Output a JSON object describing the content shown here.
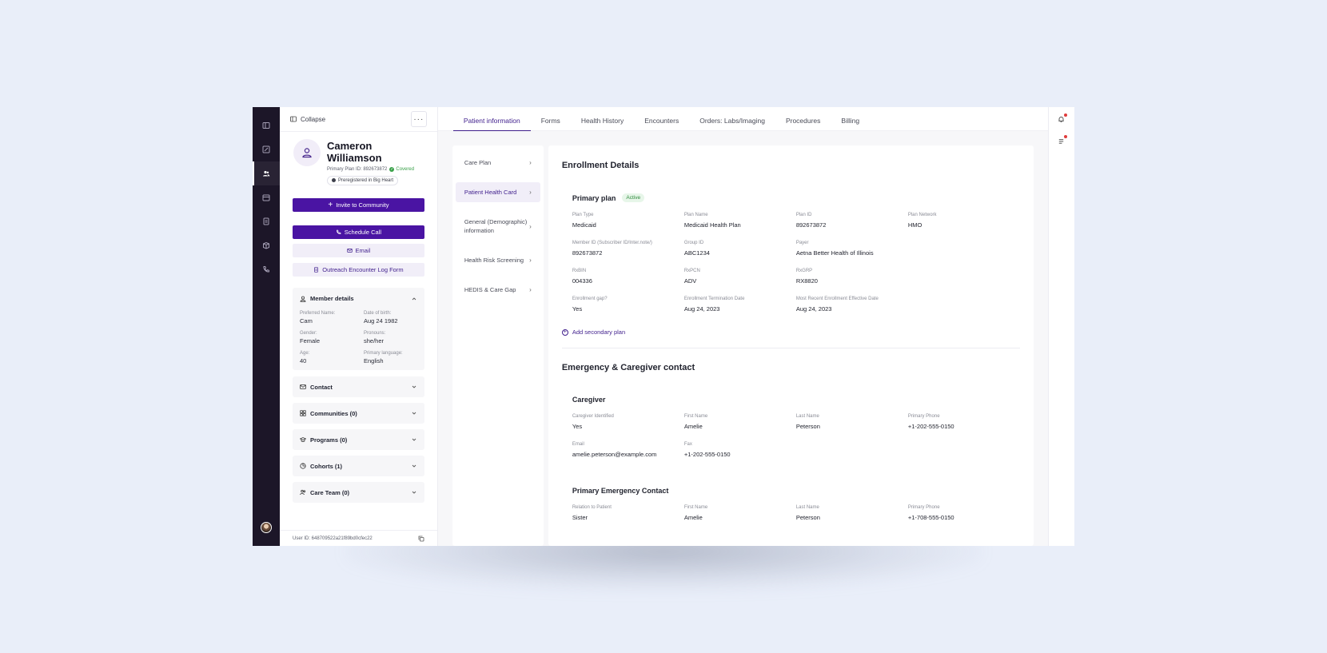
{
  "colors": {
    "accent": "#4a14a3",
    "rail": "#1c1628",
    "covered": "#3aa14a",
    "active_badge_bg": "#e7f6e9",
    "notification": "#e03c3c"
  },
  "rail": {
    "icons": [
      "sidebar-toggle-icon",
      "edit-note-icon",
      "users-icon",
      "calendar-icon",
      "document-icon",
      "box-icon",
      "phone-icon"
    ],
    "active_index": 2
  },
  "panel": {
    "collapse_label": "Collapse",
    "more_label": "···",
    "patient": {
      "name": "Cameron Williamson",
      "primary_plan_id": "Primary Plan ID: 892673872",
      "coverage_status": "Covered",
      "preregistered": "Preregistered in Big Heart"
    },
    "buttons": {
      "invite": "Invite to Community",
      "schedule": "Schedule Call",
      "email": "Email",
      "outreach": "Outreach Encounter Log Form"
    },
    "member_details": {
      "title": "Member details",
      "fields": [
        {
          "label": "Preferred Name:",
          "value": "Cam"
        },
        {
          "label": "Date of birth:",
          "value": "Aug 24 1982"
        },
        {
          "label": "Gender:",
          "value": "Female"
        },
        {
          "label": "Pronouns:",
          "value": "she/her"
        },
        {
          "label": "Age:",
          "value": "40"
        },
        {
          "label": "Primary language:",
          "value": "English"
        }
      ]
    },
    "sections": [
      "Contact",
      "Communities (0)",
      "Programs (0)",
      "Cohorts (1)",
      "Care Team (0)"
    ],
    "user_id": "User ID: 648709522a21f89bd0cfec22"
  },
  "tabs": [
    "Patient information",
    "Forms",
    "Health History",
    "Encounters",
    "Orders: Labs/Imaging",
    "Procedures",
    "Billing"
  ],
  "active_tab": 0,
  "subnav": [
    "Care Plan",
    "Patient Health Card",
    "General (Demographic) information",
    "Health Risk Screening",
    "HEDIS & Care Gap"
  ],
  "active_subnav": 1,
  "enrollment": {
    "title": "Enrollment Details",
    "primary_plan": {
      "title": "Primary plan",
      "status": "Active",
      "rows": [
        [
          {
            "label": "Plan Type",
            "value": "Medicaid"
          },
          {
            "label": "Plan Name",
            "value": "Medicaid Health Plan"
          },
          {
            "label": "Plan ID",
            "value": "892673872"
          },
          {
            "label": "Plan Network",
            "value": "HMO"
          }
        ],
        [
          {
            "label": "Member ID (Subscriber ID/Inter.note/)",
            "value": "892673872"
          },
          {
            "label": "Group ID",
            "value": "ABC1234"
          },
          {
            "label": "Payer",
            "value": "Aetna Better Health of Illinois"
          }
        ],
        [
          {
            "label": "RxBIN",
            "value": "004336"
          },
          {
            "label": "RxPCN",
            "value": "ADV"
          },
          {
            "label": "RxGRP",
            "value": "RX8820"
          }
        ],
        [
          {
            "label": "Enrollment gap?",
            "value": "Yes"
          },
          {
            "label": "Enrollment Termination Date",
            "value": "Aug 24, 2023"
          },
          {
            "label": "Most Recent Enrollment Effective Date",
            "value": "Aug 24, 2023"
          }
        ]
      ]
    },
    "add_secondary": "Add secondary plan"
  },
  "emergency": {
    "title": "Emergency & Caregiver contact",
    "caregiver": {
      "title": "Caregiver",
      "rows": [
        [
          {
            "label": "Caregiver Identified",
            "value": "Yes"
          },
          {
            "label": "First Name",
            "value": "Amelie"
          },
          {
            "label": "Last Name",
            "value": "Peterson"
          },
          {
            "label": "Primary Phone",
            "value": "+1-202-555-0150"
          }
        ],
        [
          {
            "label": "Email",
            "value": "amelie.peterson@example.com"
          },
          {
            "label": "Fax",
            "value": "+1-202-555-0150"
          }
        ]
      ]
    },
    "primary_contact": {
      "title": "Primary Emergency Contact",
      "rows": [
        [
          {
            "label": "Relation to Patient",
            "value": "Sister"
          },
          {
            "label": "First Name",
            "value": "Amelie"
          },
          {
            "label": "Last Name",
            "value": "Peterson"
          },
          {
            "label": "Primary Phone",
            "value": "+1-708-555-0150"
          }
        ]
      ]
    }
  },
  "right_rail": {
    "icons": [
      "bell-icon",
      "checklist-icon"
    ]
  }
}
